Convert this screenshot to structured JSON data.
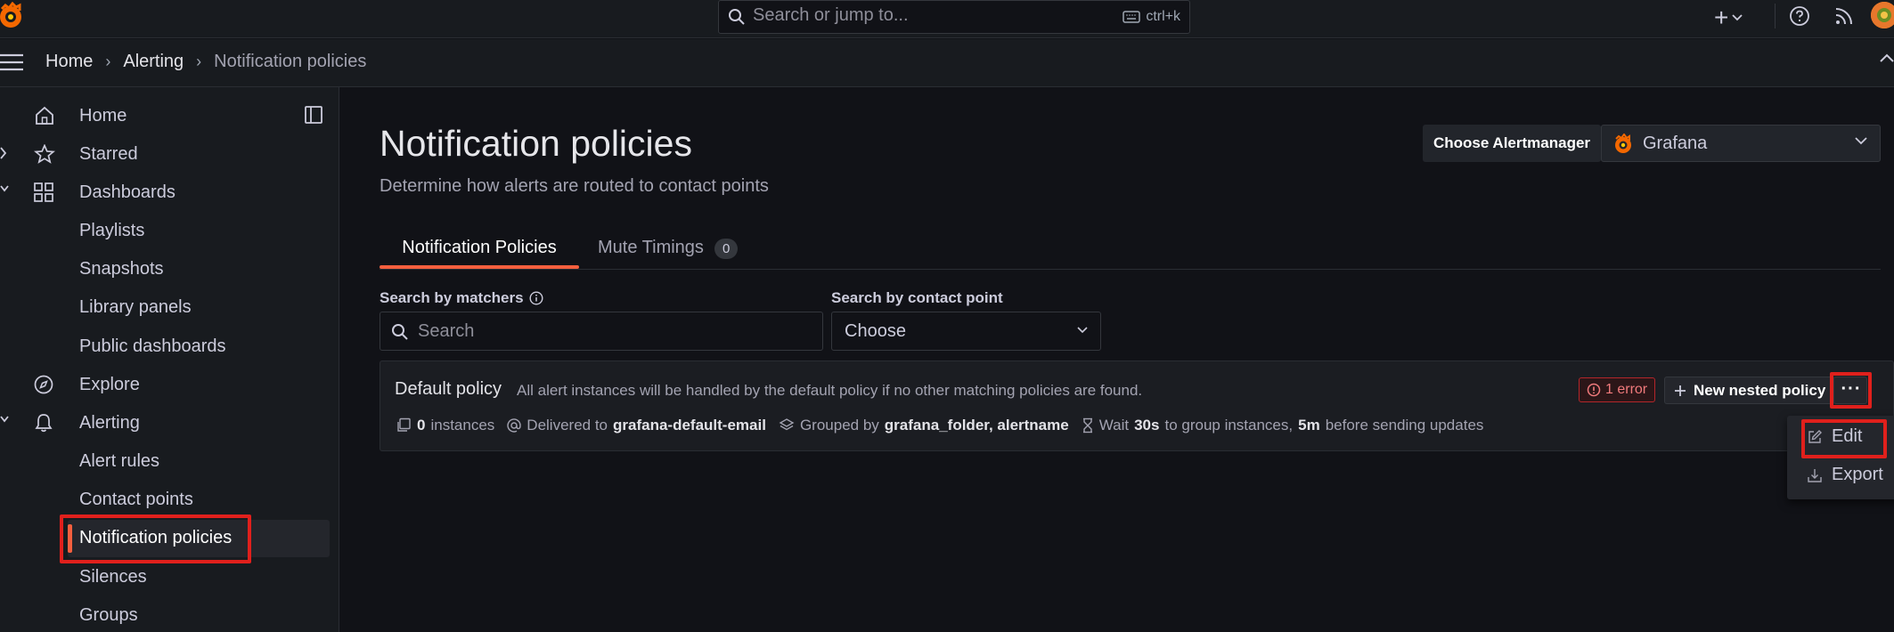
{
  "topbar": {
    "search_placeholder": "Search or jump to...",
    "shortcut": "ctrl+k",
    "plus": "+"
  },
  "breadcrumb": [
    "Home",
    "Alerting",
    "Notification policies"
  ],
  "sidebar": {
    "items": [
      {
        "label": "Home",
        "icon": "home-icon"
      },
      {
        "label": "Starred",
        "icon": "star-icon"
      },
      {
        "label": "Dashboards",
        "icon": "apps-icon"
      },
      {
        "label": "Playlists"
      },
      {
        "label": "Snapshots"
      },
      {
        "label": "Library panels"
      },
      {
        "label": "Public dashboards"
      },
      {
        "label": "Explore",
        "icon": "compass-icon"
      },
      {
        "label": "Alerting",
        "icon": "bell-icon"
      },
      {
        "label": "Alert rules"
      },
      {
        "label": "Contact points"
      },
      {
        "label": "Notification policies",
        "active": true
      },
      {
        "label": "Silences"
      },
      {
        "label": "Groups"
      }
    ]
  },
  "page": {
    "title": "Notification policies",
    "subtitle": "Determine how alerts are routed to contact points",
    "alertmanager_label": "Choose Alertmanager",
    "alertmanager_value": "Grafana"
  },
  "tabs": [
    {
      "label": "Notification Policies",
      "active": true
    },
    {
      "label": "Mute Timings",
      "count": "0"
    }
  ],
  "filters": {
    "matchers_label": "Search by matchers",
    "matchers_placeholder": "Search",
    "contact_label": "Search by contact point",
    "contact_placeholder": "Choose"
  },
  "policy": {
    "name": "Default policy",
    "description": "All alert instances will be handled by the default policy if no other matching policies are found.",
    "error_badge": "1 error",
    "new_nested": "New nested policy",
    "more": "···",
    "instances_count": "0",
    "instances_label": "instances",
    "delivered_label": "Delivered to",
    "delivered_value": "grafana-default-email",
    "grouped_label": "Grouped by",
    "grouped_value": "grafana_folder, alertname",
    "wait_label": "Wait",
    "wait_value": "30s",
    "wait_suffix": "to group instances,",
    "repeat_value": "5m",
    "repeat_suffix": "before sending updates"
  },
  "menu": {
    "edit": "Edit",
    "export": "Export"
  },
  "colors": {
    "accent": "#f55f3e",
    "highlight": "#e0201c",
    "error": "#f17a7c",
    "background": "#111217",
    "panel": "#181b1f"
  }
}
